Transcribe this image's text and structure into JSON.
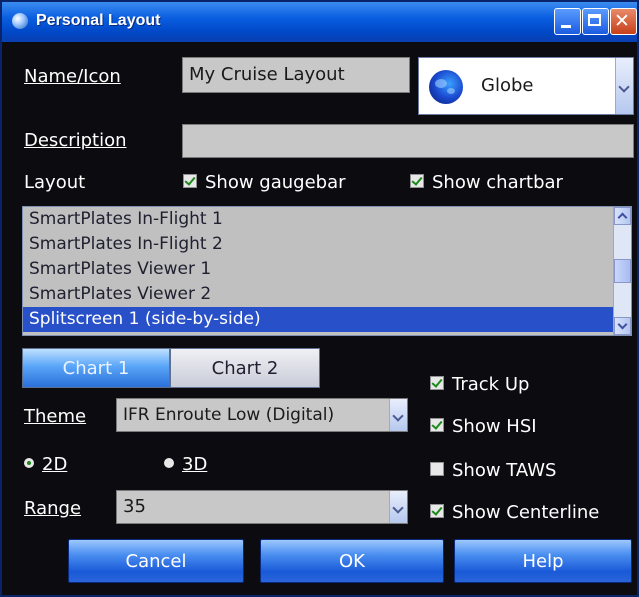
{
  "window": {
    "title": "Personal Layout"
  },
  "form": {
    "name_label": "Name/Icon",
    "name_value": "My Cruise Layout",
    "icon_value": "Globe",
    "description_label": "Description",
    "description_value": "",
    "layout_label": "Layout",
    "show_gaugebar": {
      "label": "Show gaugebar",
      "checked": true
    },
    "show_chartbar": {
      "label": "Show chartbar",
      "checked": true
    }
  },
  "layouts": {
    "items": [
      "SmartPlates In-Flight 1",
      "SmartPlates In-Flight 2",
      "SmartPlates Viewer 1",
      "SmartPlates Viewer 2",
      "Splitscreen 1 (side-by-side)"
    ],
    "selected_index": 4
  },
  "tabs": [
    "Chart 1",
    "Chart 2"
  ],
  "chart": {
    "theme_label": "Theme",
    "theme_value": "IFR Enroute Low (Digital)",
    "mode_2d": "2D",
    "mode_3d": "3D",
    "range_label": "Range",
    "range_value": "35",
    "options": [
      {
        "label": "Track Up",
        "checked": true
      },
      {
        "label": "Show HSI",
        "checked": true
      },
      {
        "label": "Show TAWS",
        "checked": false
      },
      {
        "label": "Show Centerline",
        "checked": true
      }
    ]
  },
  "buttons": {
    "cancel": "Cancel",
    "ok": "OK",
    "help": "Help"
  },
  "colors": {
    "title_bar": "#0a5ee0",
    "selection": "#2850c8",
    "background": "#0c0c10"
  },
  "icons": {
    "app": "globe-icon",
    "layout_icon": "globe-icon"
  }
}
